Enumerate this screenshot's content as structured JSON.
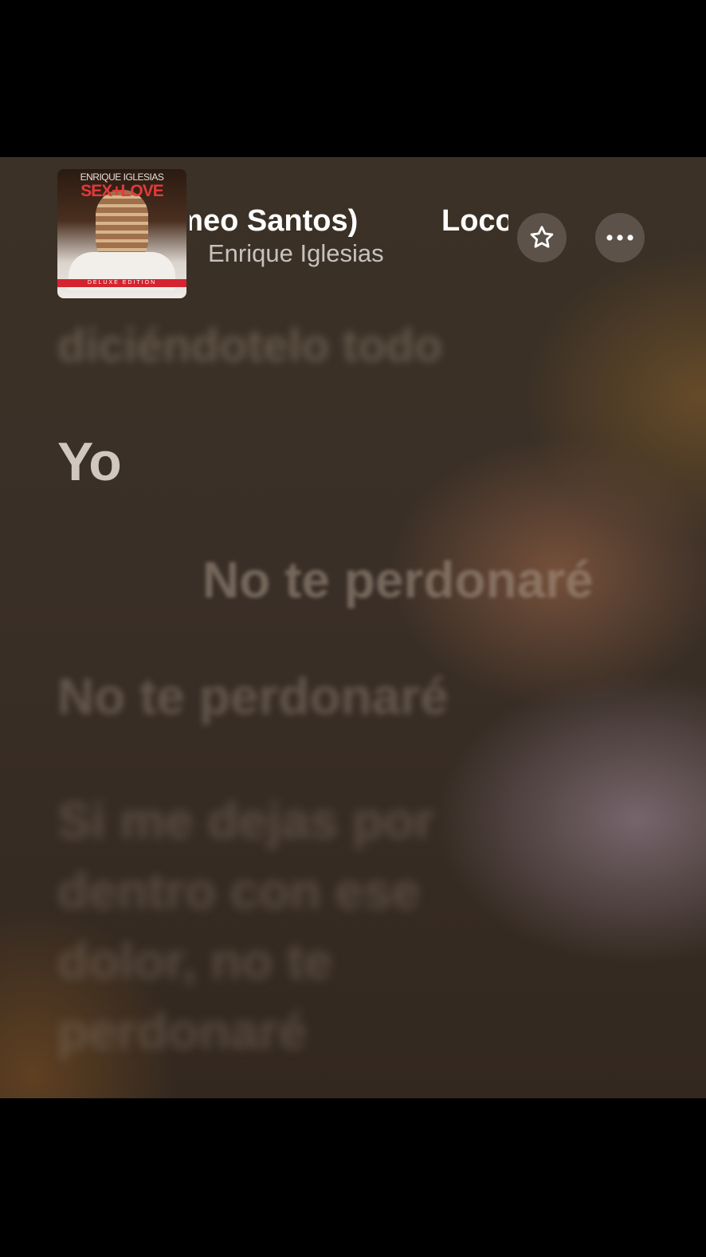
{
  "now_playing": {
    "album_art": {
      "artist_text": "ENRIQUE IGLESIAS",
      "title_text": "SEX+LOVE",
      "edition_text": "DELUXE EDITION"
    },
    "title_scroll_visible_a": "omeo Santos)",
    "title_scroll_visible_b": "Loco",
    "artist": "Enrique Iglesias",
    "star_icon": "star-outline-icon",
    "more_icon": "ellipsis-icon"
  },
  "lyrics": {
    "previous_line": "diciéndotelo todo",
    "current_line": "Yo",
    "next_line_1": "No te perdonaré",
    "next_line_2": "No te perdonaré",
    "next_line_3": "Si me dejas por dentro con ese dolor, no te perdonaré"
  },
  "colors": {
    "background_base": "#3a2f27",
    "accent_warm": "#80563e",
    "text_primary": "#ffffff",
    "text_secondary": "#c8c2bd"
  }
}
